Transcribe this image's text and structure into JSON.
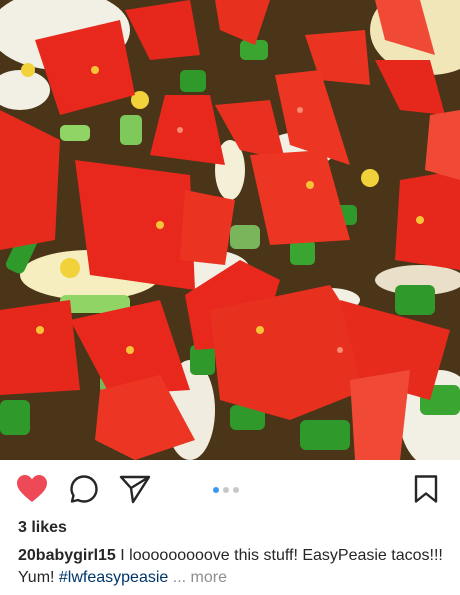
{
  "post": {
    "photo": {
      "icon": "food-photo",
      "colors": {
        "tomato": "#e8281c",
        "tomato_light": "#f4513f",
        "onion_green": "#2f9a2b",
        "onion_light": "#8fd464",
        "onion_white": "#f2f0e4",
        "meat": "#4a3518",
        "cheese": "#f2d23a"
      }
    },
    "actions": {
      "like_icon": "heart-icon",
      "like_color": "#ed4956",
      "liked": true,
      "comment_icon": "comment-icon",
      "share_icon": "send-icon",
      "save_icon": "bookmark-icon"
    },
    "carousel": {
      "count": 3,
      "active_index": 0,
      "active_color": "#3897f0",
      "inactive_color": "#c7c7c7"
    },
    "likes_text": "3 likes",
    "caption": {
      "username": "20babygirl15",
      "text": " I looooooooove this stuff! EasyPeasie tacos!!! Yum! ",
      "hashtag": "#lwfeasypeasie",
      "more_label": "... more"
    }
  }
}
